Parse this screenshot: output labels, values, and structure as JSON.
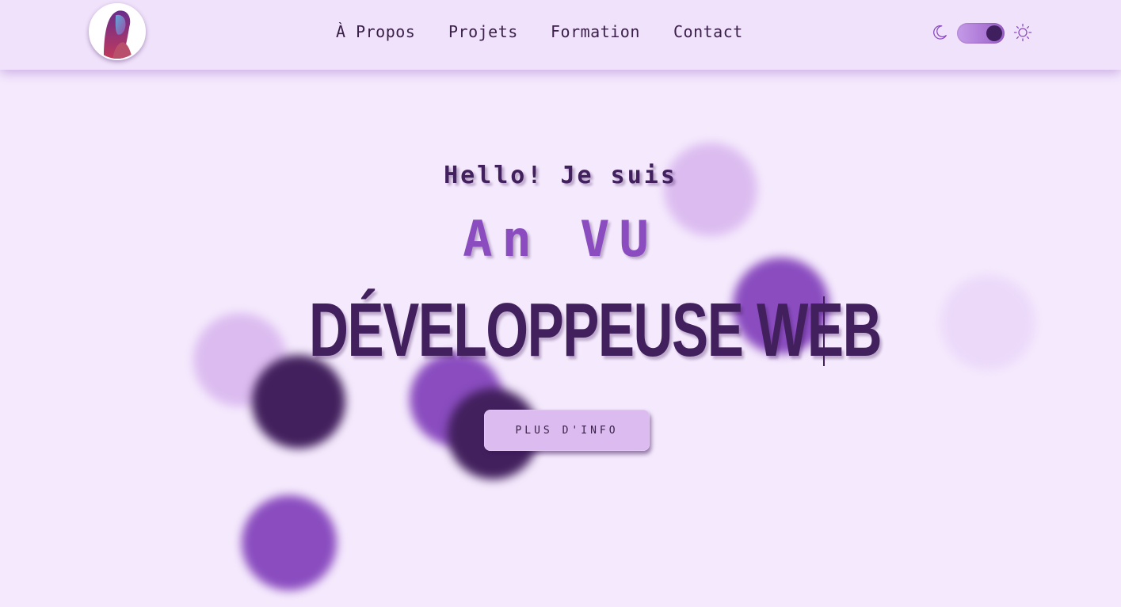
{
  "header": {
    "avatar_alt": "Profile photo",
    "nav": [
      {
        "label": "À Propos"
      },
      {
        "label": "Projets"
      },
      {
        "label": "Formation"
      },
      {
        "label": "Contact"
      }
    ],
    "theme_toggle": {
      "state": "dark",
      "left_icon": "moon-icon",
      "right_icon": "sun-icon"
    }
  },
  "hero": {
    "greeting": "Hello! Je suis",
    "name": "An VU",
    "role": "DÉVELOPPEUSE WEB",
    "cta_label": "PLUS D'INFO"
  },
  "colors": {
    "background": "#f5eafd",
    "header": "#f0e2fb",
    "dark_purple": "#42205d",
    "medium_purple": "#8a4cbf",
    "light_purple": "#dcbcf0"
  }
}
